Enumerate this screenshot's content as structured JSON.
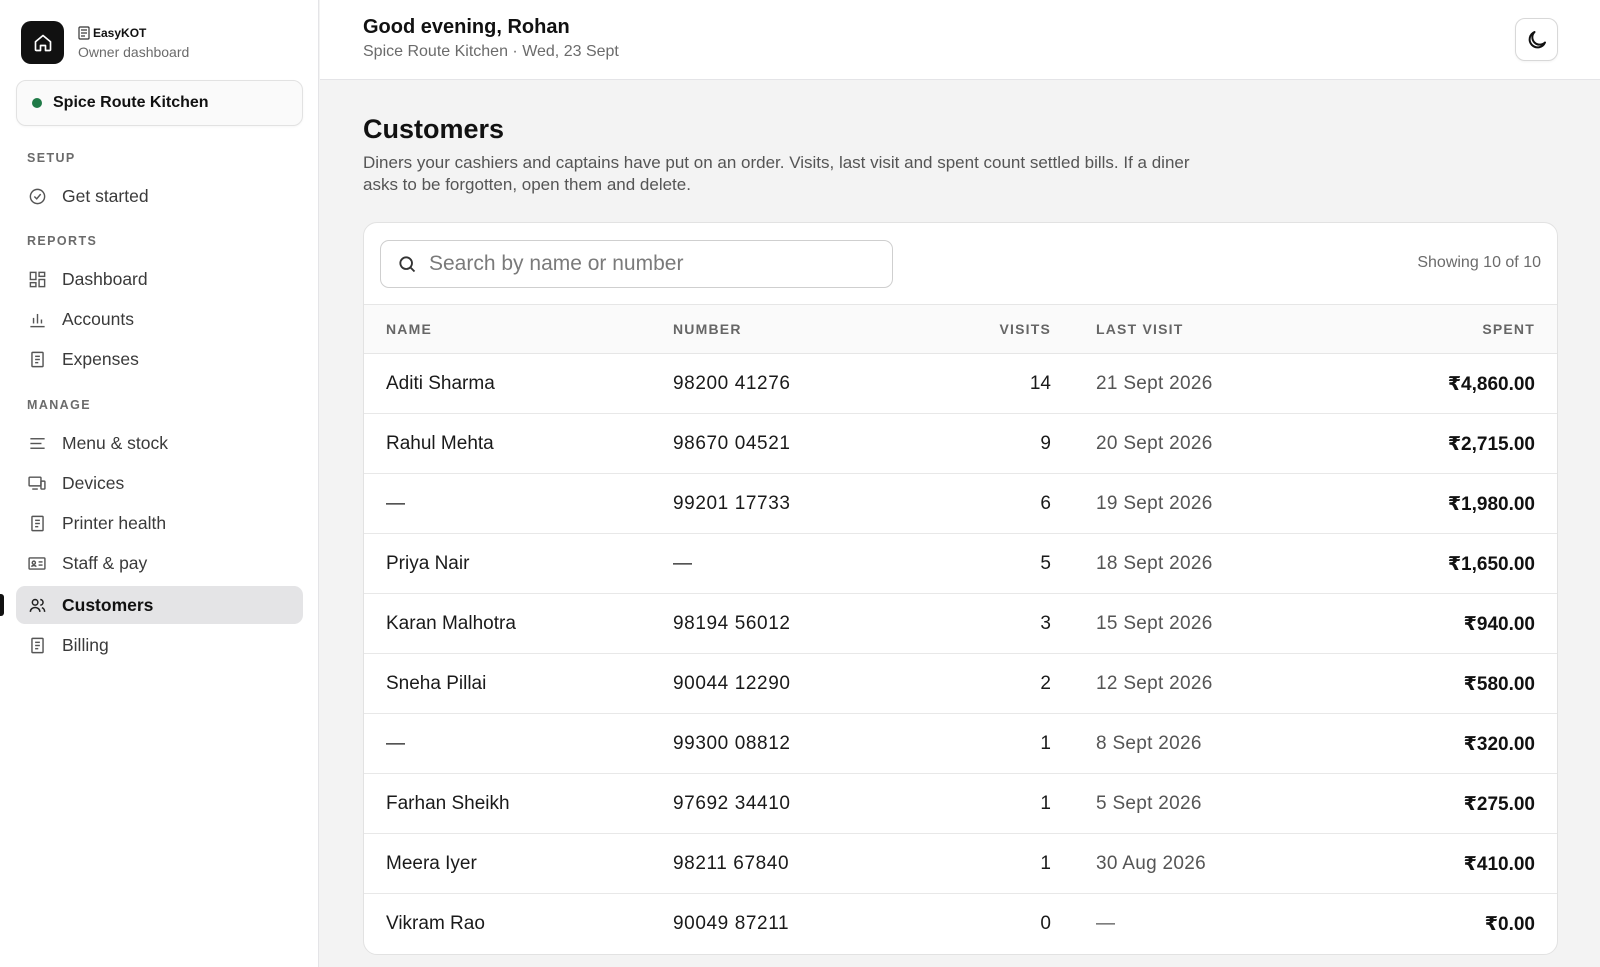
{
  "brand": {
    "name": "EasyKOT",
    "subtitle": "Owner dashboard"
  },
  "restaurant": {
    "name": "Spice Route Kitchen",
    "status_color": "#1f7a47"
  },
  "nav": {
    "setup_label": "SETUP",
    "reports_label": "REPORTS",
    "manage_label": "MANAGE",
    "items": [
      {
        "label": "Get started",
        "icon": "check-circle-icon"
      },
      {
        "label": "Dashboard",
        "icon": "dashboard-grid-icon"
      },
      {
        "label": "Accounts",
        "icon": "bar-chart-icon"
      },
      {
        "label": "Expenses",
        "icon": "receipt-icon"
      },
      {
        "label": "Menu & stock",
        "icon": "menu-lines-icon"
      },
      {
        "label": "Devices",
        "icon": "devices-icon"
      },
      {
        "label": "Printer health",
        "icon": "printer-doc-icon"
      },
      {
        "label": "Staff & pay",
        "icon": "id-card-icon"
      },
      {
        "label": "Customers",
        "icon": "users-icon",
        "active": true
      },
      {
        "label": "Billing",
        "icon": "bill-icon"
      }
    ]
  },
  "header": {
    "greeting": "Good evening, Rohan",
    "subtitle": "Spice Route Kitchen · Wed, 23 Sept",
    "theme_icon": "moon-icon"
  },
  "page": {
    "title": "Customers",
    "description": "Diners your cashiers and captains have put on an order. Visits, last visit and spent count settled bills. If a diner asks to be forgotten, open them and delete."
  },
  "search": {
    "placeholder": "Search by name or number",
    "value": ""
  },
  "showing": "Showing 10 of 10",
  "table": {
    "columns": [
      "NAME",
      "NUMBER",
      "VISITS",
      "LAST VISIT",
      "SPENT"
    ],
    "rows": [
      {
        "name": "Aditi Sharma",
        "number": "98200 41276",
        "visits": "14",
        "last_visit": "21 Sept 2026",
        "spent": "₹4,860.00"
      },
      {
        "name": "Rahul Mehta",
        "number": "98670 04521",
        "visits": "9",
        "last_visit": "20 Sept 2026",
        "spent": "₹2,715.00"
      },
      {
        "name": "—",
        "number": "99201 17733",
        "visits": "6",
        "last_visit": "19 Sept 2026",
        "spent": "₹1,980.00"
      },
      {
        "name": "Priya Nair",
        "number": "—",
        "visits": "5",
        "last_visit": "18 Sept 2026",
        "spent": "₹1,650.00"
      },
      {
        "name": "Karan Malhotra",
        "number": "98194 56012",
        "visits": "3",
        "last_visit": "15 Sept 2026",
        "spent": "₹940.00"
      },
      {
        "name": "Sneha Pillai",
        "number": "90044 12290",
        "visits": "2",
        "last_visit": "12 Sept 2026",
        "spent": "₹580.00"
      },
      {
        "name": "—",
        "number": "99300 08812",
        "visits": "1",
        "last_visit": "8 Sept 2026",
        "spent": "₹320.00"
      },
      {
        "name": "Farhan Sheikh",
        "number": "97692 34410",
        "visits": "1",
        "last_visit": "5 Sept 2026",
        "spent": "₹275.00"
      },
      {
        "name": "Meera Iyer",
        "number": "98211 67840",
        "visits": "1",
        "last_visit": "30 Aug 2026",
        "spent": "₹410.00"
      },
      {
        "name": "Vikram Rao",
        "number": "90049 87211",
        "visits": "0",
        "last_visit": "—",
        "spent": "₹0.00"
      }
    ]
  }
}
